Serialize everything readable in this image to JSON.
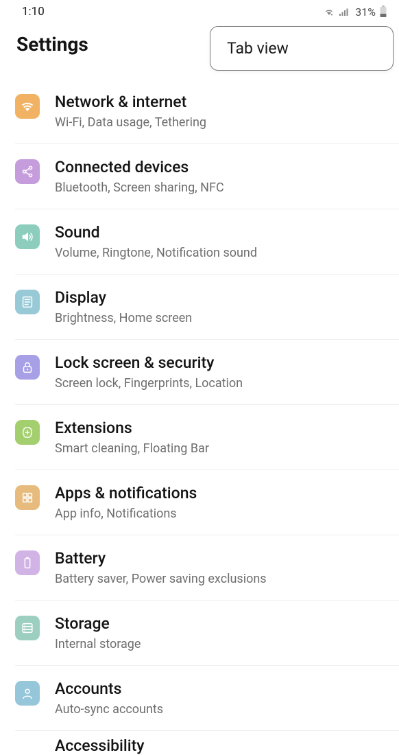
{
  "status": {
    "time": "1:10",
    "battery_pct": "31%"
  },
  "header": {
    "title": "Settings",
    "tab_view": "Tab view"
  },
  "items": [
    {
      "title": "Network & internet",
      "subtitle": "Wi-Fi, Data usage, Tethering"
    },
    {
      "title": "Connected devices",
      "subtitle": "Bluetooth, Screen sharing, NFC"
    },
    {
      "title": "Sound",
      "subtitle": "Volume, Ringtone, Notification sound"
    },
    {
      "title": "Display",
      "subtitle": "Brightness, Home screen"
    },
    {
      "title": "Lock screen & security",
      "subtitle": "Screen lock, Fingerprints, Location"
    },
    {
      "title": "Extensions",
      "subtitle": "Smart cleaning, Floating Bar"
    },
    {
      "title": "Apps & notifications",
      "subtitle": "App info, Notifications"
    },
    {
      "title": "Battery",
      "subtitle": "Battery saver, Power saving exclusions"
    },
    {
      "title": "Storage",
      "subtitle": "Internal storage"
    },
    {
      "title": "Accounts",
      "subtitle": "Auto-sync accounts"
    }
  ],
  "partial_item_title": "Accessibility"
}
